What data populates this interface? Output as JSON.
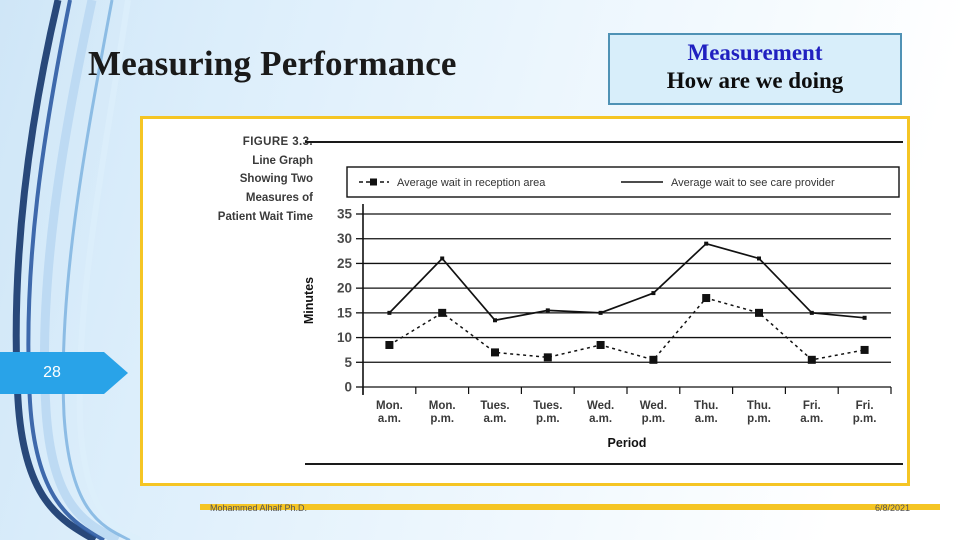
{
  "slide": {
    "title": "Measuring Performance",
    "page_number": "28",
    "footer_author": "Mohammed Alhalf Ph.D.",
    "footer_date": "6/8/2021",
    "accent_blue": "#2020c0",
    "banner_blue": "#29a3e8",
    "frame_yellow": "#f5c524",
    "box_fill": "#d8eefa",
    "box_border": "#4f92b5"
  },
  "measurement_box": {
    "line1": "Measurement",
    "line2": "How are we doing"
  },
  "figure": {
    "caption_line1": "FIGURE 3.3.",
    "caption_line2": "Line Graph",
    "caption_line3": "Showing Two",
    "caption_line4": "Measures of",
    "caption_line5": "Patient Wait Time"
  },
  "chart_data": {
    "type": "line",
    "title": "",
    "xlabel": "Period",
    "ylabel": "Minutes",
    "ylim": [
      0,
      35
    ],
    "yticks": [
      0,
      5,
      10,
      15,
      20,
      25,
      30,
      35
    ],
    "grid": true,
    "legend_position": "top",
    "categories": [
      "Mon. a.m.",
      "Mon. p.m.",
      "Tues. a.m.",
      "Tues. p.m.",
      "Wed. a.m.",
      "Wed. p.m.",
      "Thu. a.m.",
      "Thu. p.m.",
      "Fri. a.m.",
      "Fri. p.m."
    ],
    "x_tick_lines": [
      [
        "Mon.",
        "a.m."
      ],
      [
        "Mon.",
        "p.m."
      ],
      [
        "Tues.",
        "a.m."
      ],
      [
        "Tues.",
        "p.m."
      ],
      [
        "Wed.",
        "a.m."
      ],
      [
        "Wed.",
        "p.m."
      ],
      [
        "Thu.",
        "a.m."
      ],
      [
        "Thu.",
        "p.m."
      ],
      [
        "Fri.",
        "a.m."
      ],
      [
        "Fri.",
        "p.m."
      ]
    ],
    "series": [
      {
        "name": "Average wait in reception area",
        "style": "dashed",
        "marker": "square",
        "values": [
          8.5,
          15,
          7,
          6,
          8.5,
          5.5,
          18,
          15,
          5.5,
          7.5
        ]
      },
      {
        "name": "Average wait to see care provider",
        "style": "solid",
        "marker": "small",
        "values": [
          15,
          26,
          13.5,
          15.5,
          15,
          19,
          29,
          26,
          15,
          14
        ]
      }
    ]
  }
}
